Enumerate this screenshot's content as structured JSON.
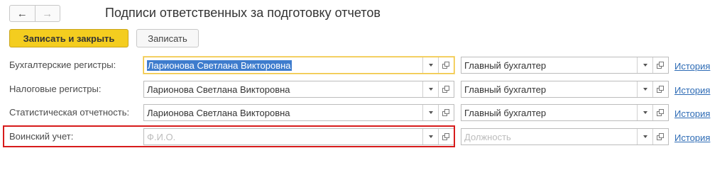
{
  "header": {
    "title": "Подписи ответственных за подготовку отчетов",
    "back_glyph": "←",
    "forward_glyph": "→"
  },
  "toolbar": {
    "save_close_label": "Записать и закрыть",
    "save_label": "Записать"
  },
  "rows": [
    {
      "label": "Бухгалтерские регистры:",
      "person": "Ларионова Светлана Викторовна",
      "position": "Главный бухгалтер",
      "history": "История"
    },
    {
      "label": "Налоговые регистры:",
      "person": "Ларионова Светлана Викторовна",
      "position": "Главный бухгалтер",
      "history": "История"
    },
    {
      "label": "Статистическая отчетность:",
      "person": "Ларионова Светлана Викторовна",
      "position": "Главный бухгалтер",
      "history": "История"
    },
    {
      "label": "Воинский учет:",
      "person_placeholder": "Ф.И.О.",
      "position_placeholder": "Должность",
      "history": "История"
    }
  ],
  "icons": [
    "arrow-left-icon",
    "arrow-right-icon",
    "dropdown-arrow-icon",
    "open-form-icon"
  ],
  "colors": {
    "primary_button": "#f4cd1f",
    "link": "#2d6bb5",
    "highlight_box": "#d71b1b",
    "selection": "#3e7ccd",
    "focus_border": "#f0c33c"
  }
}
